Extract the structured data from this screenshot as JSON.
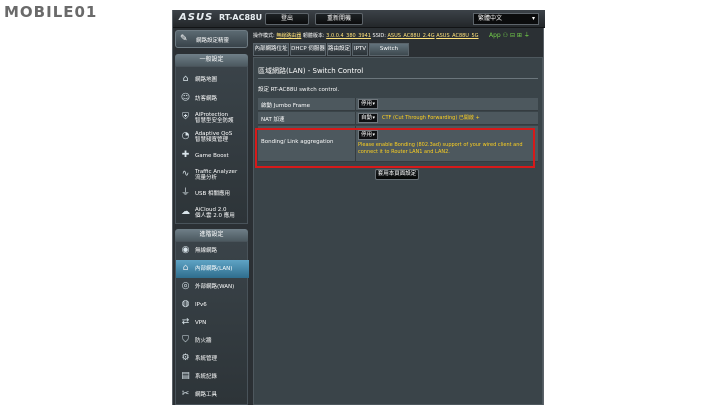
{
  "watermark": {
    "text": "MOBILE01"
  },
  "header": {
    "brand": "ASUS",
    "model": "RT-AC88U",
    "logout_label": "登出",
    "reboot_label": "重新開機",
    "language": "繁體中文"
  },
  "status": {
    "mode_label": "操作模式:",
    "mode_value": "無線路由器",
    "firmware_label": "韌體版本:",
    "firmware_value": "3.0.0.4_380_3941",
    "ssid_label": "SSID:",
    "ssid_24": "ASUS_AC88U_2.4G",
    "ssid_5": "ASUS_AC88U_5G",
    "app_label": "App"
  },
  "sidebar": {
    "quick_setup": "網路設定精靈",
    "general_title": "一般設定",
    "general_items": [
      {
        "icon": "network-map-icon",
        "label": "網路地圖"
      },
      {
        "icon": "guest-network-icon",
        "label": "訪客網路"
      },
      {
        "icon": "aiprotection-icon",
        "label": "AiProtection\n智慧型安全防護"
      },
      {
        "icon": "adaptive-qos-icon",
        "label": "Adaptive QoS\n智慧頻寬管理"
      },
      {
        "icon": "game-boost-icon",
        "label": "Game Boost"
      },
      {
        "icon": "traffic-analyzer-icon",
        "label": "Traffic Analyzer\n流量分析"
      },
      {
        "icon": "usb-icon",
        "label": "USB 相關應用"
      },
      {
        "icon": "aicloud-icon",
        "label": "AiCloud 2.0\n個人雲 2.0 應用"
      }
    ],
    "advanced_title": "進階設定",
    "advanced_items": [
      {
        "icon": "wireless-icon",
        "label": "無線網路"
      },
      {
        "icon": "lan-icon",
        "label": "內部網路(LAN)"
      },
      {
        "icon": "wan-icon",
        "label": "外部網路(WAN)"
      },
      {
        "icon": "ipv6-icon",
        "label": "IPv6"
      },
      {
        "icon": "vpn-icon",
        "label": "VPN"
      },
      {
        "icon": "firewall-icon",
        "label": "防火牆"
      },
      {
        "icon": "administration-icon",
        "label": "系統管理"
      },
      {
        "icon": "system-log-icon",
        "label": "系統記錄"
      },
      {
        "icon": "network-tools-icon",
        "label": "網路工具"
      }
    ]
  },
  "tabs": [
    "內部網路位址",
    "DHCP 伺服器",
    "路由設定",
    "IPTV",
    "Switch Control"
  ],
  "panel": {
    "title": "區域網路(LAN) - Switch Control",
    "description": "設定 RT-AC88U switch control.",
    "rows": [
      {
        "label": "啟動 Jumbo Frame",
        "value": "停用"
      },
      {
        "label": "NAT 加速",
        "value": "自動",
        "note": "CTF (Cut Through Forwarding) 已開啟 +"
      },
      {
        "label": "Bonding/ Link aggregation",
        "value": "停用",
        "note": "Please enable Bonding (802.3ad) support of your wired client and connect it to Router LAN1 and LAN2."
      }
    ],
    "apply_label": "套用本頁面設定"
  }
}
